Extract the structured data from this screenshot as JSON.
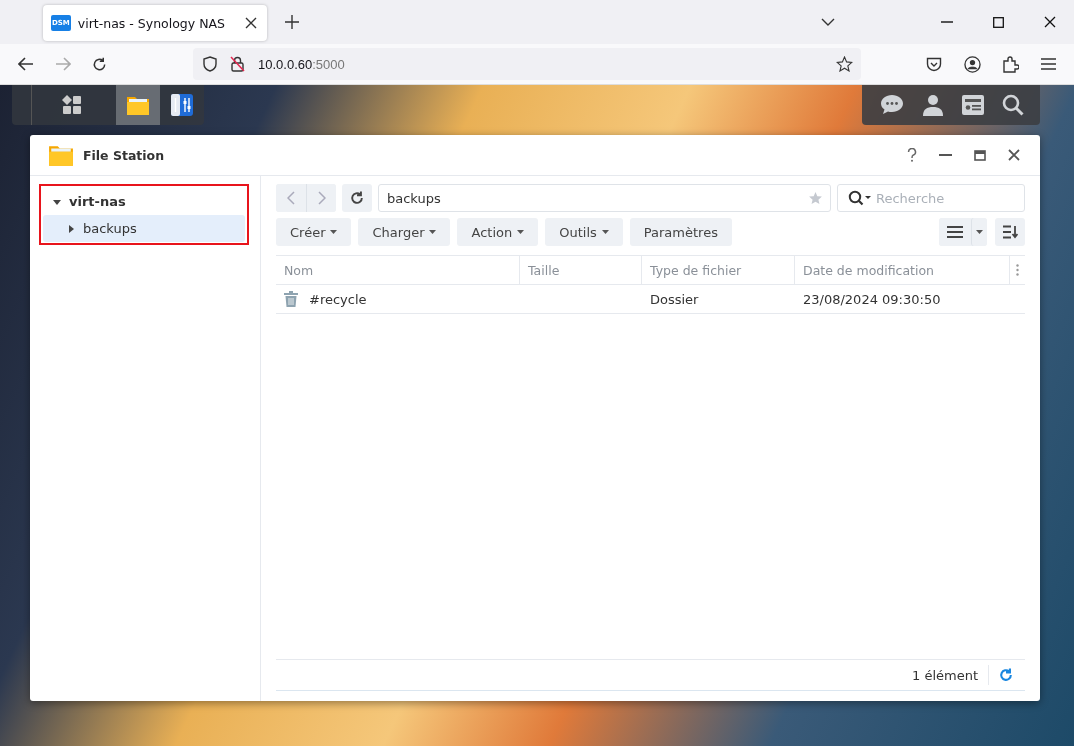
{
  "browser": {
    "tab": {
      "title": "virt-nas - Synology NAS",
      "favicon": "DSM"
    },
    "url_host": "10.0.0.60",
    "url_port": ":5000"
  },
  "window": {
    "title": "File Station"
  },
  "tree": [
    {
      "label": "virt-nas",
      "expanded": true,
      "selected": false,
      "children": [
        {
          "label": "backups",
          "expanded": false,
          "selected": true
        }
      ]
    }
  ],
  "path": "backups",
  "search": {
    "placeholder": "Recherche"
  },
  "toolbar": [
    {
      "label": "Créer",
      "dropdown": true
    },
    {
      "label": "Charger",
      "dropdown": true
    },
    {
      "label": "Action",
      "dropdown": true
    },
    {
      "label": "Outils",
      "dropdown": true
    },
    {
      "label": "Paramètres",
      "dropdown": false
    }
  ],
  "table": {
    "columns": [
      "Nom",
      "Taille",
      "Type de fichier",
      "Date de modification"
    ],
    "rows": [
      {
        "name": "#recycle",
        "size": "",
        "type": "Dossier",
        "modified": "23/08/2024 09:30:50"
      }
    ]
  },
  "status": "1 élément"
}
